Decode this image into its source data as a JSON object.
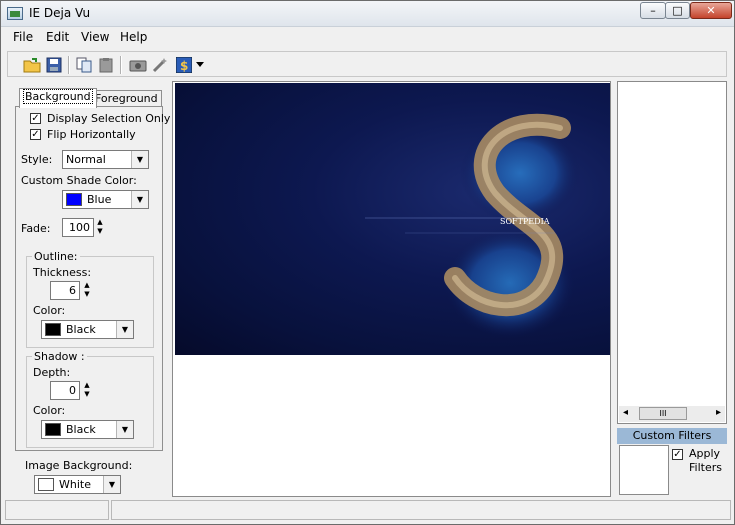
{
  "window": {
    "title": "IE Deja Vu",
    "minimize": "–",
    "maximize": "□",
    "close": "✕"
  },
  "menu": [
    "File",
    "Edit",
    "View",
    "Help"
  ],
  "toolbar": {
    "icons": [
      "open-folder-icon",
      "save-disk-icon",
      "copy-icon",
      "paste-icon",
      "camera-icon",
      "magic-wand-icon",
      "filter-dollar-icon",
      "dropdown-arrow-icon"
    ]
  },
  "tabs": {
    "background": "Background",
    "foreground": "Foreground"
  },
  "background": {
    "display_selection_only": {
      "label": "Display Selection Only",
      "checked": "✓"
    },
    "flip_horizontally": {
      "label": "Flip Horizontally",
      "checked": "✓"
    },
    "style_label": "Style:",
    "style_value": "Normal",
    "shade_label": "Custom Shade Color:",
    "shade_value": "Blue",
    "shade_color": "#0000ff",
    "fade_label": "Fade:",
    "fade_value": "100",
    "outline": {
      "label": "Outline:",
      "thickness_label": "Thickness:",
      "thickness_value": "6",
      "color_label": "Color:",
      "color_value": "Black",
      "color_hex": "#000000"
    },
    "shadow": {
      "label": "Shadow :",
      "depth_label": "Depth:",
      "depth_value": "0",
      "color_label": "Color:",
      "color_value": "Black",
      "color_hex": "#000000"
    },
    "image_bg_label": "Image Background:",
    "image_bg_value": "White",
    "image_bg_hex": "#ffffff"
  },
  "picture": {
    "watermark": "SOFTPEDIA"
  },
  "right": {
    "scroll_thumb": "III",
    "left_arrow": "◂",
    "right_arrow": "▸",
    "custom_filters_label": "Custom Filters",
    "apply_label": "Apply",
    "filters_label": "Filters",
    "apply_checked": "✓"
  }
}
